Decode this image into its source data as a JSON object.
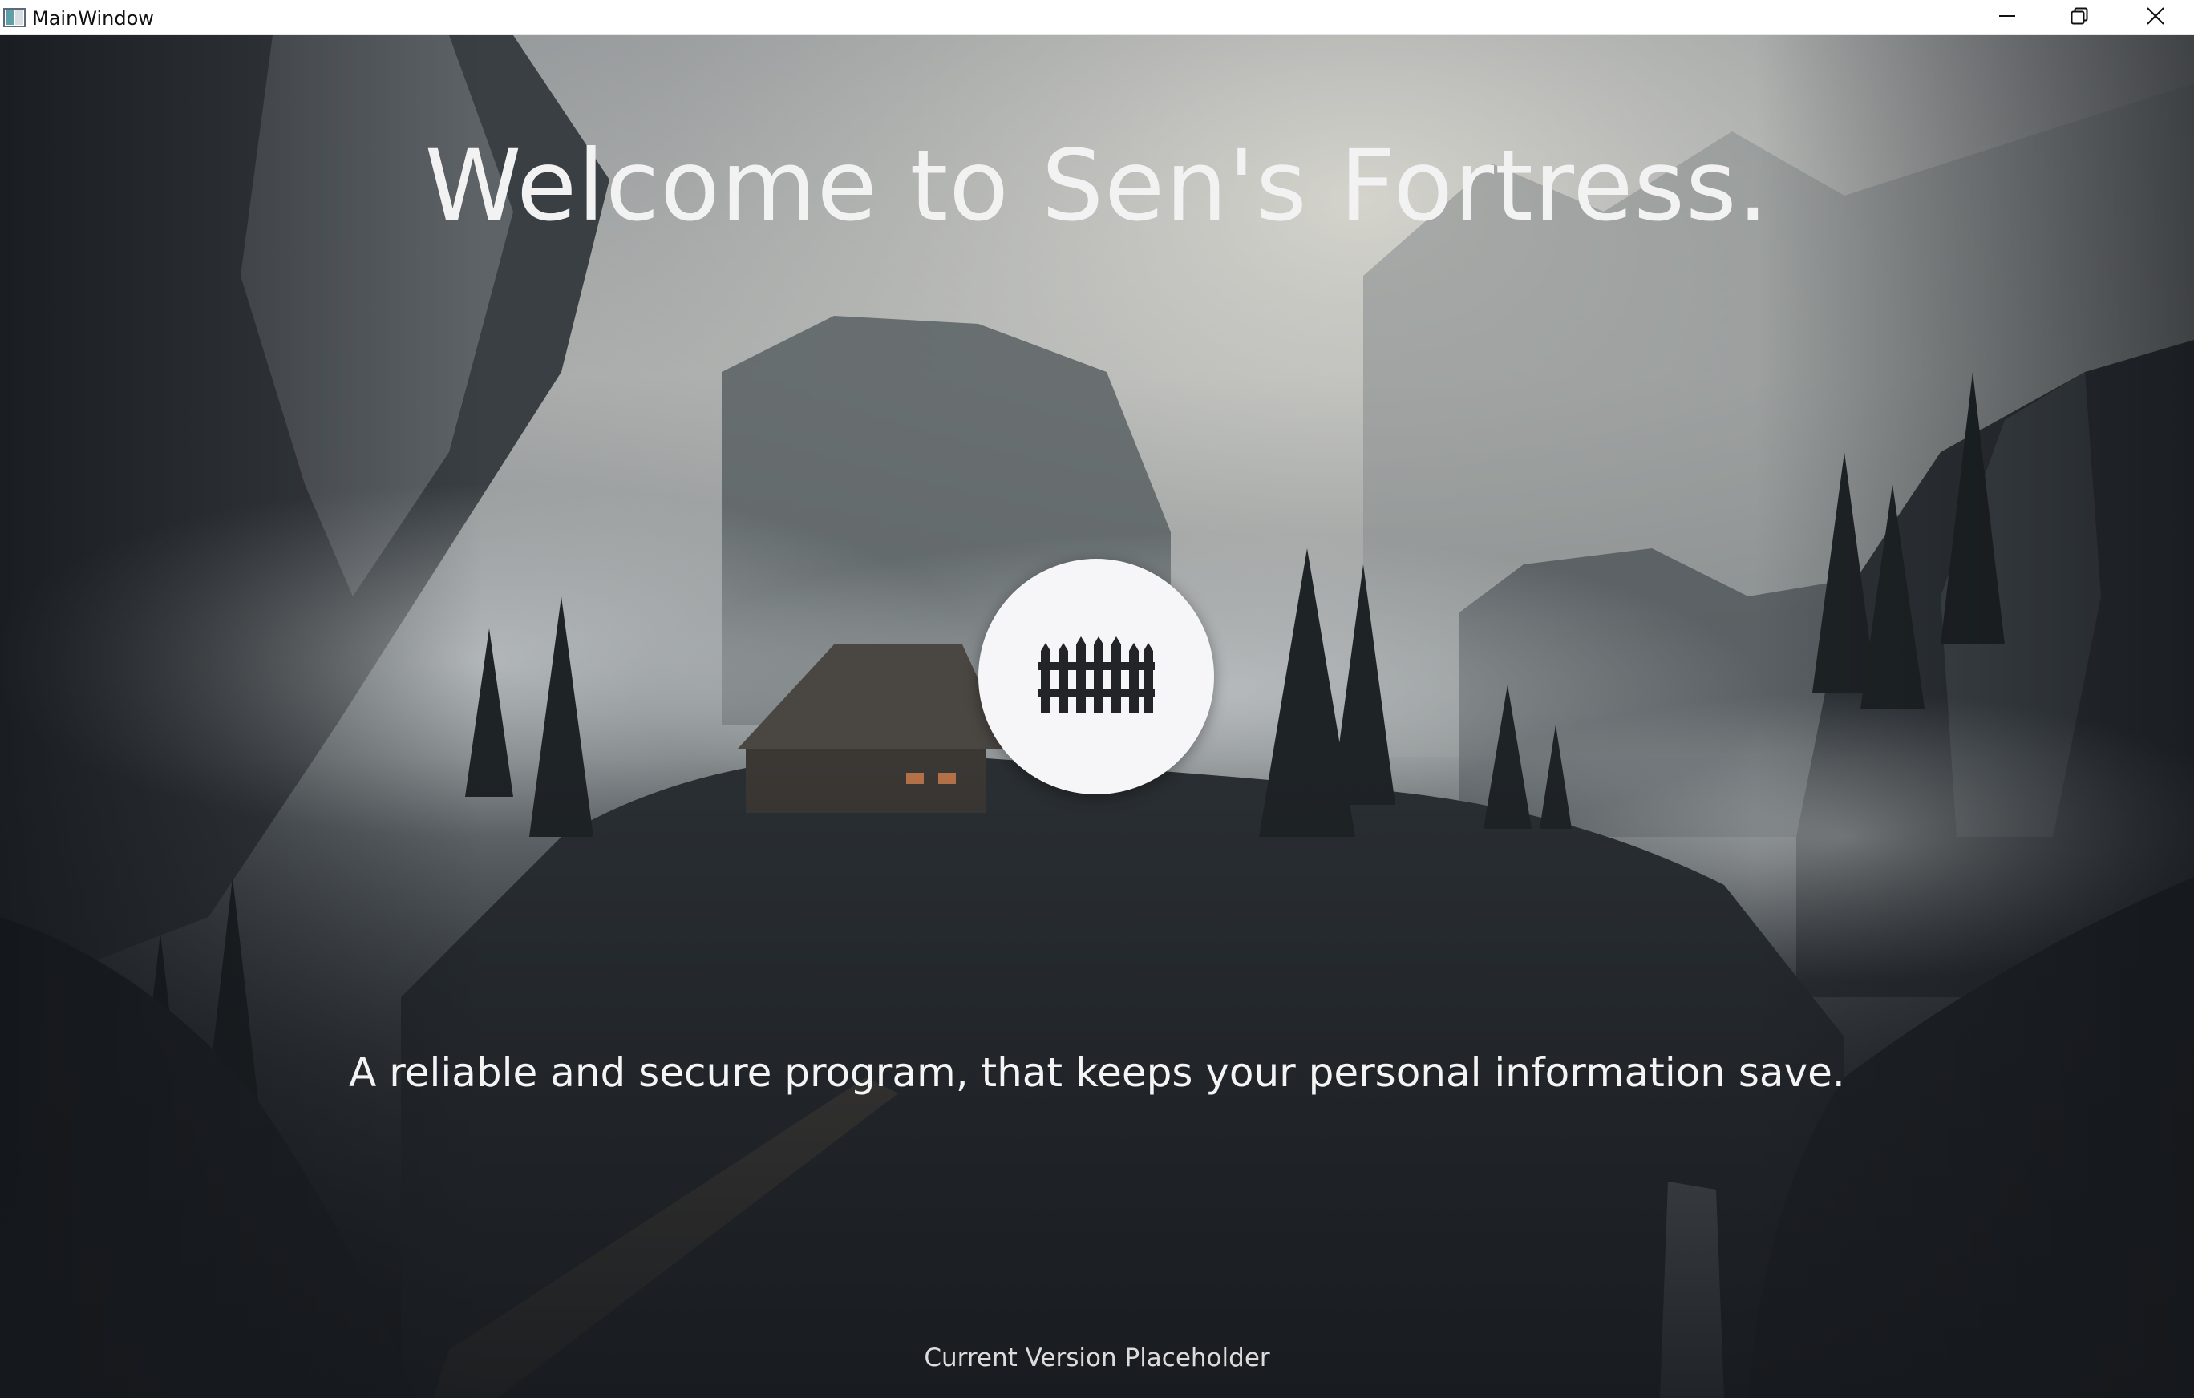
{
  "window": {
    "title": "MainWindow",
    "app_icon": "window-app-icon",
    "controls": {
      "minimize_icon": "minimize-icon",
      "restore_icon": "restore-icon",
      "close_icon": "close-icon"
    }
  },
  "main": {
    "title": "Welcome to Sen's Fortress.",
    "logo_icon": "fence-icon",
    "tagline": "A reliable and secure program, that keeps your personal information save.",
    "version": "Current Version Placeholder"
  },
  "colors": {
    "titlebar_bg": "#ffffff",
    "text_light": "#f2f2f2",
    "logo_circle": "#f6f6f8",
    "logo_icon": "#222428",
    "close_hover": "#e81123"
  }
}
